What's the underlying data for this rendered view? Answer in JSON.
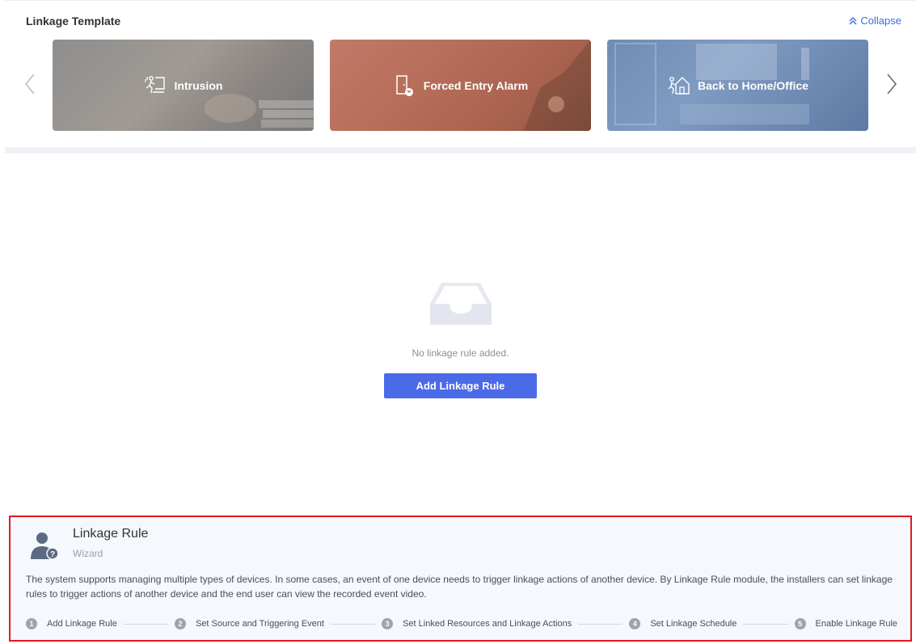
{
  "template": {
    "title": "Linkage Template",
    "collapse_label": "Collapse",
    "cards": [
      {
        "label": "Intrusion",
        "icon": "intrusion-icon"
      },
      {
        "label": "Forced Entry Alarm",
        "icon": "forced-entry-icon"
      },
      {
        "label": "Back to Home/Office",
        "icon": "home-icon"
      }
    ]
  },
  "empty_state": {
    "message": "No linkage rule added.",
    "button_label": "Add Linkage Rule"
  },
  "wizard": {
    "title": "Linkage Rule",
    "subtitle": "Wizard",
    "description": "The system supports managing multiple types of devices. In some cases, an event of one device needs to trigger linkage actions of another device. By Linkage Rule module, the installers can set linkage rules to trigger actions of another device and the end user can view the recorded event video.",
    "steps": [
      {
        "num": "1",
        "label": "Add Linkage Rule"
      },
      {
        "num": "2",
        "label": "Set Source and Triggering Event"
      },
      {
        "num": "3",
        "label": "Set Linked Resources and Linkage Actions"
      },
      {
        "num": "4",
        "label": "Set Linkage Schedule"
      },
      {
        "num": "5",
        "label": "Enable Linkage Rule"
      }
    ]
  },
  "colors": {
    "accent": "#4b6ae8",
    "link": "#3b6dd8",
    "highlight_border": "#e31a1c"
  }
}
